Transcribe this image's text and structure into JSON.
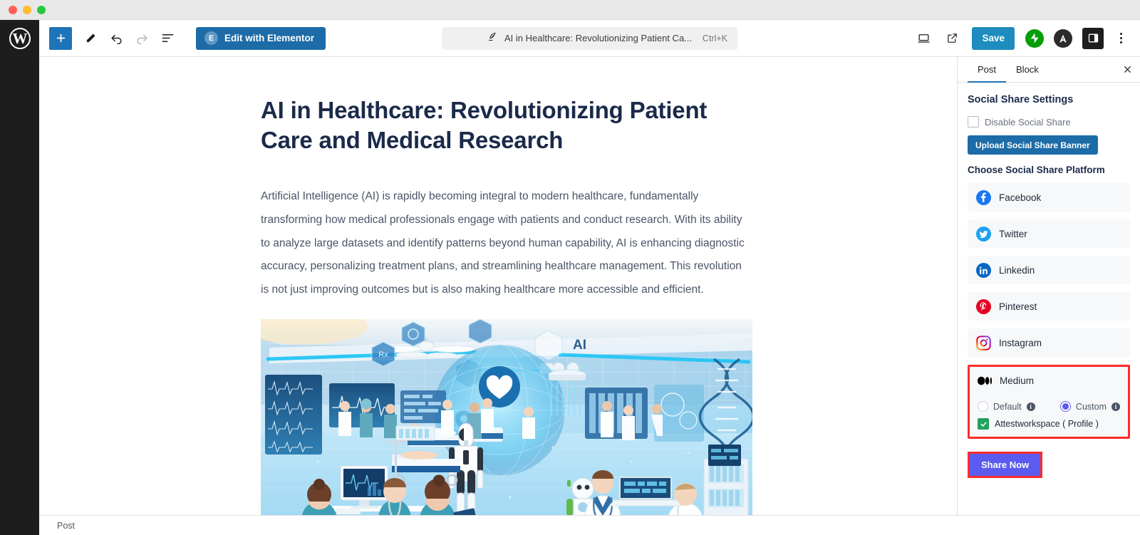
{
  "window": {
    "traffic_lights": [
      "close",
      "minimize",
      "maximize"
    ]
  },
  "toolbar": {
    "wordpress_logo": "wordpress-icon",
    "add_block_label": "+",
    "tools": [
      {
        "name": "add-block-button",
        "label": "+"
      },
      {
        "name": "edit-tool-button",
        "label": "pencil-icon"
      },
      {
        "name": "undo-button",
        "label": "undo-icon"
      },
      {
        "name": "redo-button",
        "label": "redo-icon"
      },
      {
        "name": "document-overview-button",
        "label": "list-view-icon"
      }
    ],
    "elementor_label": "Edit with Elementor",
    "elementor_badge": "E",
    "command_title": "AI in Healthcare: Revolutionizing Patient Ca...",
    "command_shortcut": "Ctrl+K",
    "view_label": "view-desktop-icon",
    "preview_label": "open-external-icon",
    "save_label": "Save",
    "jetpack_label": "jetpack-icon",
    "astra_label": "astra-icon",
    "sidebar_toggle_label": "settings-sidebar-icon",
    "options_label": "more-options-icon"
  },
  "post": {
    "title": "AI in Healthcare: Revolutionizing Patient Care and Medical Research",
    "paragraph": "Artificial Intelligence (AI) is rapidly becoming integral to modern healthcare, fundamentally transforming how medical professionals engage with patients and conduct research. With its ability to analyze large datasets and identify patterns beyond human capability, AI is enhancing diagnostic accuracy, personalizing treatment plans, and streamlining healthcare management. This revolution is not just improving outcomes but is also making healthcare more accessible and efficient.",
    "figure_alt": "futuristic-hospital-ai-illustration"
  },
  "statusbar": {
    "breadcrumb": "Post"
  },
  "panel": {
    "tabs": [
      {
        "label": "Post",
        "active": true
      },
      {
        "label": "Block",
        "active": false
      }
    ],
    "close_label": "×",
    "heading": "Social Share Settings",
    "disable_label": "Disable Social Share",
    "disable_checked": false,
    "upload_label": "Upload Social Share Banner",
    "choose_label": "Choose Social Share Platform",
    "platforms": [
      {
        "label": "Facebook",
        "icon": "facebook-icon",
        "color": "#1877f2"
      },
      {
        "label": "Twitter",
        "icon": "twitter-icon",
        "color": "#1da1f2"
      },
      {
        "label": "Linkedin",
        "icon": "linkedin-icon",
        "color": "#0a66c2"
      },
      {
        "label": "Pinterest",
        "icon": "pinterest-icon",
        "color": "#e60023"
      },
      {
        "label": "Instagram",
        "icon": "instagram-icon",
        "color": "#e1306c"
      }
    ],
    "medium": {
      "label": "Medium",
      "icon": "medium-icon",
      "highlight_color": "#ff2b2b",
      "options": [
        {
          "label": "Default",
          "selected": false
        },
        {
          "label": "Custom",
          "selected": true
        }
      ],
      "info_label": "info-icon",
      "profile_label": "Attestworkspace ( Profile )",
      "profile_checked": true,
      "profile_check_color": "#22a25c"
    },
    "share_label": "Share Now",
    "share_color": "#5b5bf0"
  }
}
